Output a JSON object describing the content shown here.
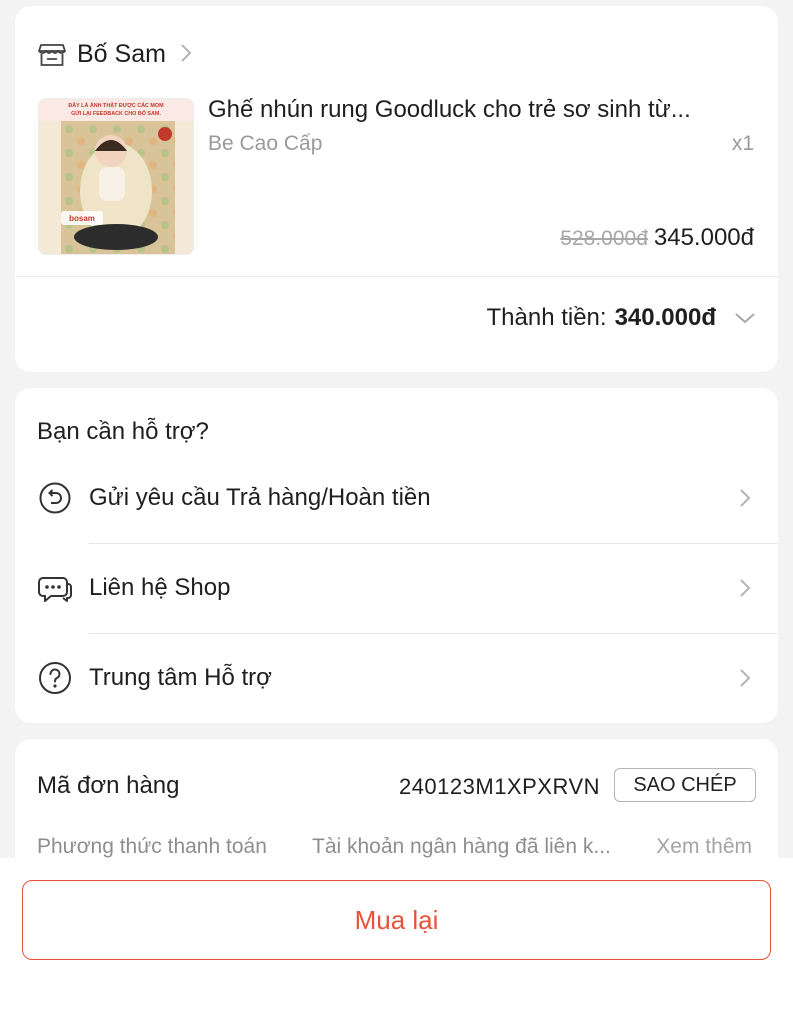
{
  "shop": {
    "name": "Bố Sam",
    "icon": "store-icon"
  },
  "product": {
    "title": "Ghế nhún rung Goodluck cho trẻ sơ sinh từ...",
    "variant": "Be Cao Cấp",
    "quantity": "x1",
    "original_price": "528.000đ",
    "price": "345.000đ",
    "thumb_caption": "ĐÂY LÀ ẢNH THẬT ĐƯỢC CÁC MOM GỬI LẠI FEEDBACK CHO BỐ SAM.",
    "thumb_brand": "bosam"
  },
  "total": {
    "label": "Thành tiền:",
    "value": "340.000đ"
  },
  "support": {
    "title": "Bạn cần hỗ trợ?",
    "items": [
      {
        "label": "Gửi yêu cầu Trả hàng/Hoàn tiền",
        "icon": "return-icon"
      },
      {
        "label": "Liên hệ Shop",
        "icon": "chat-icon"
      },
      {
        "label": "Trung tâm Hỗ trợ",
        "icon": "help-icon"
      }
    ]
  },
  "order": {
    "label": "Mã đơn hàng",
    "code": "240123M1XPXRVN",
    "copy_label": "SAO CHÉP",
    "payment_label": "Phương thức thanh toán",
    "payment_value": "Tài khoản ngân hàng đã liên k...",
    "see_more": "Xem thêm"
  },
  "actions": {
    "buy_again": "Mua lại"
  },
  "colors": {
    "accent": "#e4533a",
    "background": "#f3f3f4"
  }
}
